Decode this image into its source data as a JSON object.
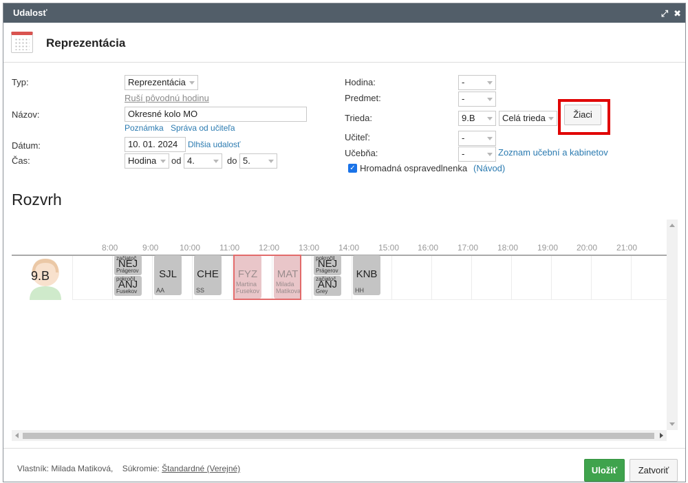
{
  "window": {
    "title": "Udalosť"
  },
  "header": {
    "title": "Reprezentácia"
  },
  "form": {
    "typ_label": "Typ:",
    "typ_value": "Reprezentácia",
    "rusi_link": "Ruší pôvodnú hodinu",
    "nazov_label": "Názov:",
    "nazov_value": "Okresné kolo MO",
    "poznamka_link": "Poznámka",
    "sprava_link": "Správa od učiteľa",
    "datum_label": "Dátum:",
    "datum_value": "10. 01. 2024",
    "dlhsia_link": "Dlhšia udalosť",
    "cas_label": "Čas:",
    "cas_value": "Hodina",
    "od_label": "od",
    "od_value": "4.",
    "do_label": "do",
    "do_value": "5.",
    "hodina_label": "Hodina:",
    "hodina_value": "-",
    "predmet_label": "Predmet:",
    "predmet_value": "-",
    "trieda_label": "Trieda:",
    "trieda_value": "9.B",
    "cela_trieda_value": "Celá trieda",
    "ziaci_button": "Žiaci",
    "ucitel_label": "Učiteľ:",
    "ucitel_value": "-",
    "ucebna_label": "Učebňa:",
    "ucebna_value": "-",
    "zoznam_link": "Zoznam učební a kabinetov",
    "hromadna_label": "Hromadná ospravedlnenka",
    "navod_link": "(Návod)",
    "hromadna_checked": true
  },
  "rozvrh": {
    "title": "Rozvrh",
    "hours": [
      "8:00",
      "9:00",
      "10:00",
      "11:00",
      "12:00",
      "13:00",
      "14:00",
      "15:00",
      "16:00",
      "17:00",
      "18:00",
      "19:00",
      "20:00",
      "21:00"
    ],
    "class_name": "9.B",
    "lessons": {
      "nej1": {
        "code": "NEJ",
        "group": "začiatoč",
        "teacher": "Prágerov"
      },
      "anj1": {
        "code": "ANJ",
        "group": "pokročil",
        "teacher": "Fusekov"
      },
      "sjl": {
        "code": "SJL",
        "teacher": "AA"
      },
      "che": {
        "code": "CHE",
        "teacher": "SS"
      },
      "fyz": {
        "code": "FYZ",
        "teacher": "Martina Fusekov"
      },
      "mat": {
        "code": "MAT",
        "teacher": "Milada Matikova"
      },
      "nej2": {
        "code": "NEJ",
        "group": "pokročil",
        "teacher": "Prágerov"
      },
      "anj2": {
        "code": "ANJ",
        "group": "začiatoč",
        "teacher": "Grey"
      },
      "knb": {
        "code": "KNB",
        "teacher": "HH"
      }
    }
  },
  "footer": {
    "owner_text": "Vlastník: Milada Matiková,",
    "privacy_label": "Súkromie:",
    "privacy_value": "Štandardné (Verejné)",
    "save_button": "Uložiť",
    "close_button": "Zatvoriť"
  },
  "colors": {
    "titlebar": "#525e69",
    "save": "#3fa34d",
    "highlight": "#e00000",
    "link": "#2a7ab0"
  }
}
